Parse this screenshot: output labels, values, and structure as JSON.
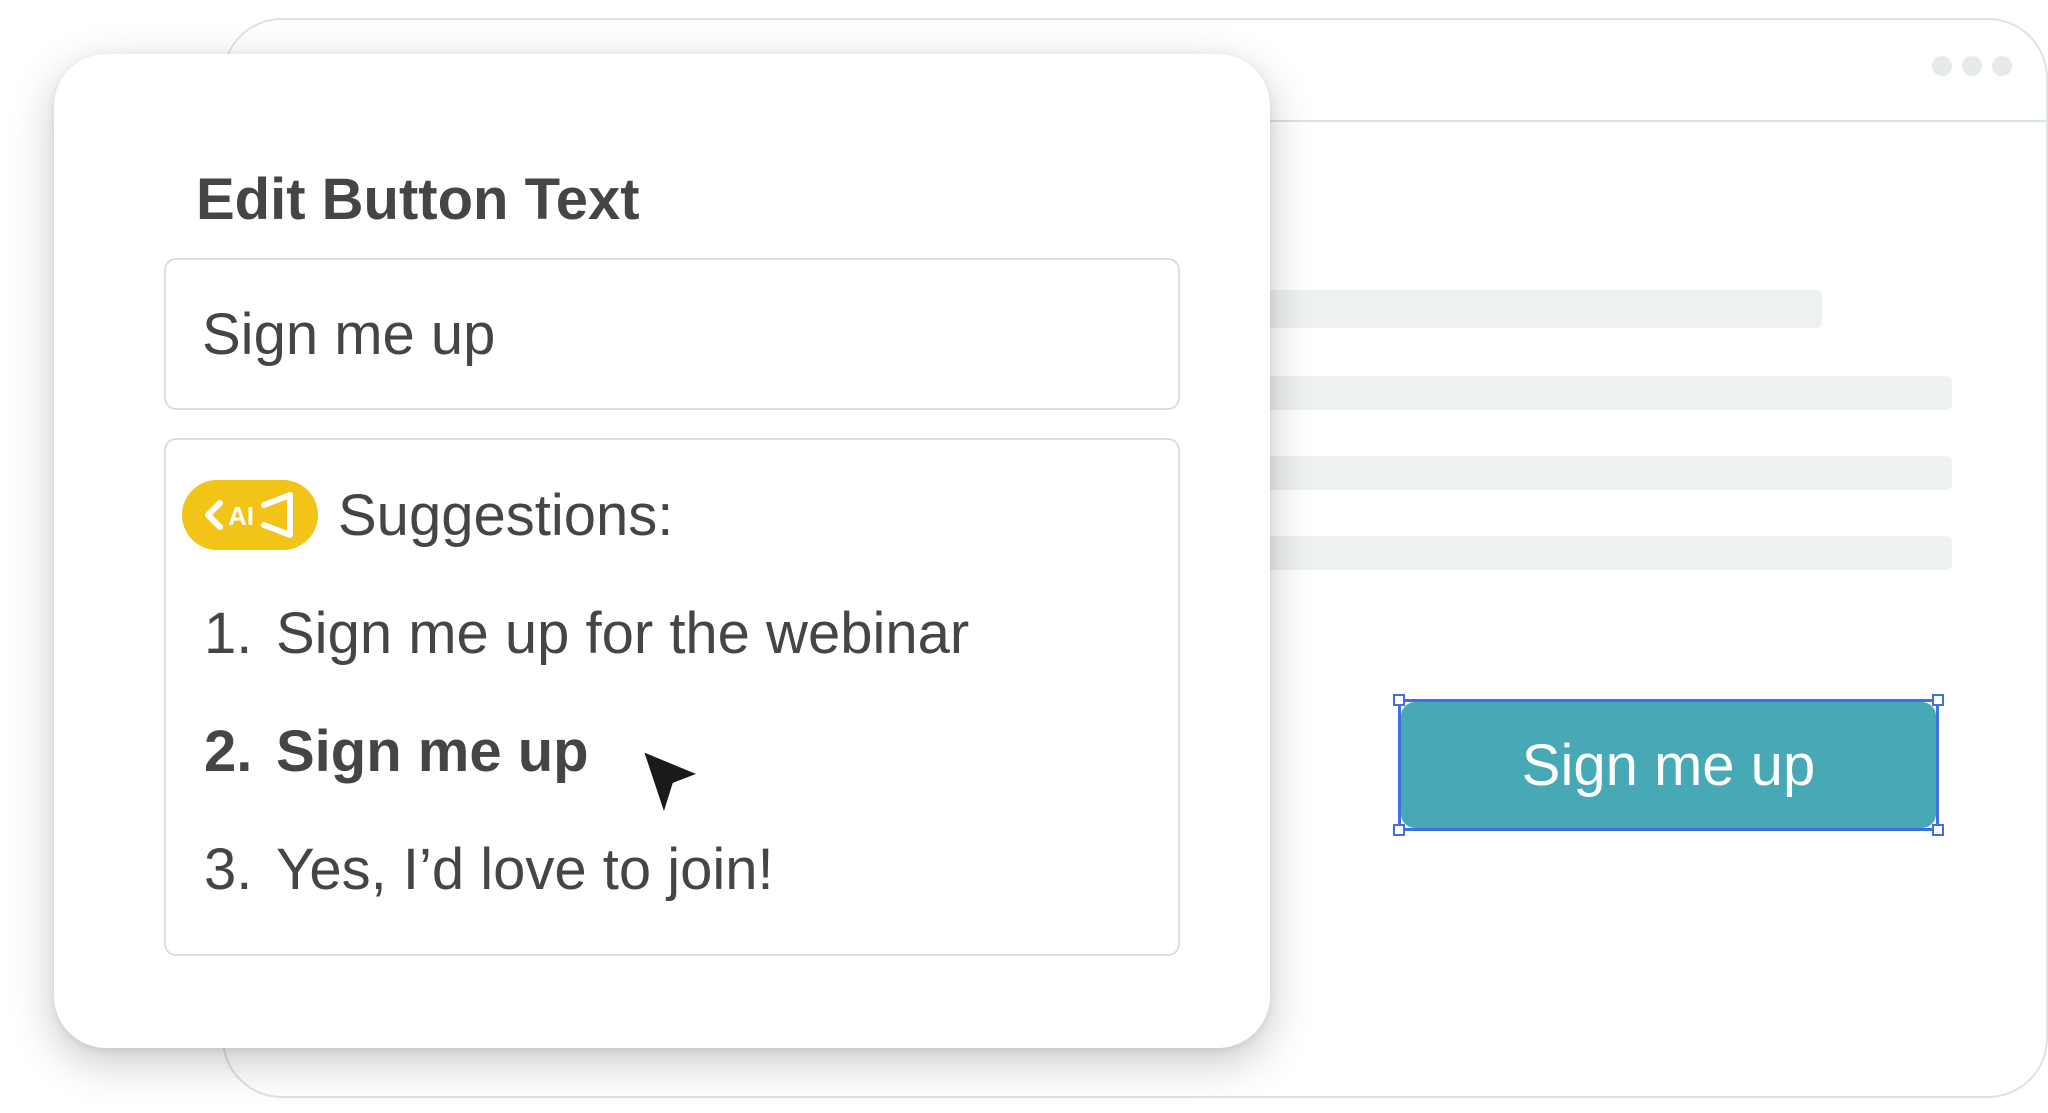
{
  "editor": {
    "title": "Edit Button Text",
    "input_value": "Sign me up",
    "suggestions_label": "Suggestions:",
    "ai_badge_icon": "ai-sparkle-icon",
    "suggestions": [
      {
        "number": "1.",
        "text": "Sign me up for the webinar"
      },
      {
        "number": "2.",
        "text": "Sign me up",
        "highlighted": true
      },
      {
        "number": "3.",
        "text": "Yes, I’d love to join!"
      }
    ]
  },
  "canvas": {
    "button_label": "Sign me up",
    "selected": true
  },
  "colors": {
    "text": "#454545",
    "border": "#d6e0e0",
    "ai_badge": "#f2c418",
    "button_bg": "#46a9b5",
    "selection": "#3f6fe0",
    "placeholder": "#eef1f1"
  }
}
